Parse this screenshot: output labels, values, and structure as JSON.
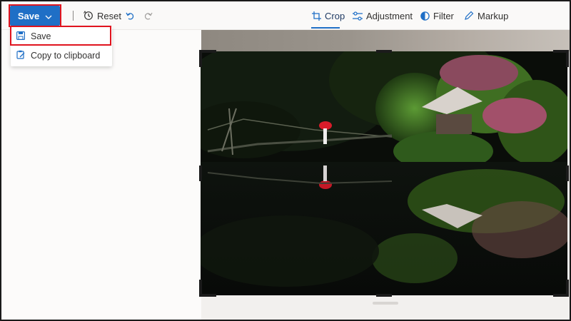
{
  "toolbar": {
    "save_label": "Save",
    "reset_label": "Reset",
    "tabs": [
      {
        "label": "Crop",
        "icon": "crop-icon",
        "active": true
      },
      {
        "label": "Adjustment",
        "icon": "adjustment-icon"
      },
      {
        "label": "Filter",
        "icon": "filter-icon"
      },
      {
        "label": "Markup",
        "icon": "markup-icon"
      }
    ]
  },
  "save_menu": {
    "items": [
      {
        "label": "Save",
        "icon": "floppy-disk-icon",
        "highlighted": true
      },
      {
        "label": "Copy to clipboard",
        "icon": "clipboard-icon"
      }
    ]
  },
  "colors": {
    "accent": "#1f6fc6",
    "highlight_outline": "#e0141e"
  }
}
